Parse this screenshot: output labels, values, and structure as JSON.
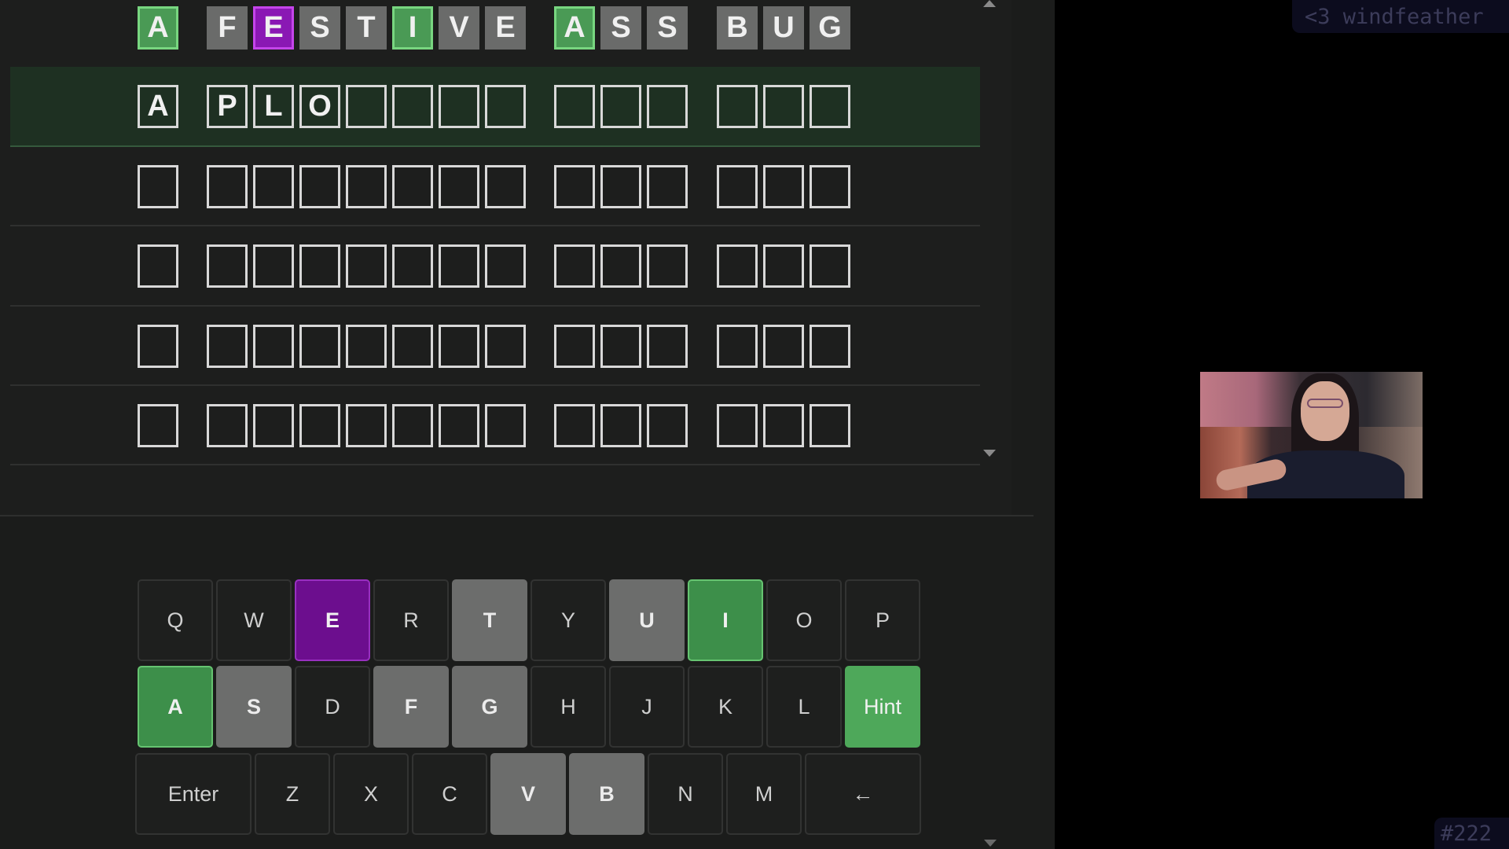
{
  "board": {
    "rows": [
      {
        "state": "revealed",
        "words": [
          [
            {
              "l": "A",
              "s": "green"
            }
          ],
          [
            {
              "l": "F",
              "s": "gray"
            },
            {
              "l": "E",
              "s": "purple"
            },
            {
              "l": "S",
              "s": "gray"
            },
            {
              "l": "T",
              "s": "gray"
            },
            {
              "l": "I",
              "s": "green"
            },
            {
              "l": "V",
              "s": "gray"
            },
            {
              "l": "E",
              "s": "gray"
            }
          ],
          [
            {
              "l": "A",
              "s": "green"
            },
            {
              "l": "S",
              "s": "gray"
            },
            {
              "l": "S",
              "s": "gray"
            }
          ],
          [
            {
              "l": "B",
              "s": "gray"
            },
            {
              "l": "U",
              "s": "gray"
            },
            {
              "l": "G",
              "s": "gray"
            }
          ]
        ]
      },
      {
        "state": "active",
        "words": [
          [
            {
              "l": "A",
              "s": "empty"
            }
          ],
          [
            {
              "l": "P",
              "s": "empty"
            },
            {
              "l": "L",
              "s": "empty"
            },
            {
              "l": "O",
              "s": "empty"
            },
            {
              "l": "",
              "s": "empty"
            },
            {
              "l": "",
              "s": "empty"
            },
            {
              "l": "",
              "s": "empty"
            },
            {
              "l": "",
              "s": "empty"
            }
          ],
          [
            {
              "l": "",
              "s": "empty"
            },
            {
              "l": "",
              "s": "empty"
            },
            {
              "l": "",
              "s": "empty"
            }
          ],
          [
            {
              "l": "",
              "s": "empty"
            },
            {
              "l": "",
              "s": "empty"
            },
            {
              "l": "",
              "s": "empty"
            }
          ]
        ]
      },
      {
        "state": "empty",
        "words": [
          [
            {
              "l": "",
              "s": "empty"
            }
          ],
          [
            {
              "l": "",
              "s": "empty"
            },
            {
              "l": "",
              "s": "empty"
            },
            {
              "l": "",
              "s": "empty"
            },
            {
              "l": "",
              "s": "empty"
            },
            {
              "l": "",
              "s": "empty"
            },
            {
              "l": "",
              "s": "empty"
            },
            {
              "l": "",
              "s": "empty"
            }
          ],
          [
            {
              "l": "",
              "s": "empty"
            },
            {
              "l": "",
              "s": "empty"
            },
            {
              "l": "",
              "s": "empty"
            }
          ],
          [
            {
              "l": "",
              "s": "empty"
            },
            {
              "l": "",
              "s": "empty"
            },
            {
              "l": "",
              "s": "empty"
            }
          ]
        ]
      },
      {
        "state": "empty",
        "words": [
          [
            {
              "l": "",
              "s": "empty"
            }
          ],
          [
            {
              "l": "",
              "s": "empty"
            },
            {
              "l": "",
              "s": "empty"
            },
            {
              "l": "",
              "s": "empty"
            },
            {
              "l": "",
              "s": "empty"
            },
            {
              "l": "",
              "s": "empty"
            },
            {
              "l": "",
              "s": "empty"
            },
            {
              "l": "",
              "s": "empty"
            }
          ],
          [
            {
              "l": "",
              "s": "empty"
            },
            {
              "l": "",
              "s": "empty"
            },
            {
              "l": "",
              "s": "empty"
            }
          ],
          [
            {
              "l": "",
              "s": "empty"
            },
            {
              "l": "",
              "s": "empty"
            },
            {
              "l": "",
              "s": "empty"
            }
          ]
        ]
      },
      {
        "state": "empty",
        "words": [
          [
            {
              "l": "",
              "s": "empty"
            }
          ],
          [
            {
              "l": "",
              "s": "empty"
            },
            {
              "l": "",
              "s": "empty"
            },
            {
              "l": "",
              "s": "empty"
            },
            {
              "l": "",
              "s": "empty"
            },
            {
              "l": "",
              "s": "empty"
            },
            {
              "l": "",
              "s": "empty"
            },
            {
              "l": "",
              "s": "empty"
            }
          ],
          [
            {
              "l": "",
              "s": "empty"
            },
            {
              "l": "",
              "s": "empty"
            },
            {
              "l": "",
              "s": "empty"
            }
          ],
          [
            {
              "l": "",
              "s": "empty"
            },
            {
              "l": "",
              "s": "empty"
            },
            {
              "l": "",
              "s": "empty"
            }
          ]
        ]
      },
      {
        "state": "empty",
        "words": [
          [
            {
              "l": "",
              "s": "empty"
            }
          ],
          [
            {
              "l": "",
              "s": "empty"
            },
            {
              "l": "",
              "s": "empty"
            },
            {
              "l": "",
              "s": "empty"
            },
            {
              "l": "",
              "s": "empty"
            },
            {
              "l": "",
              "s": "empty"
            },
            {
              "l": "",
              "s": "empty"
            },
            {
              "l": "",
              "s": "empty"
            }
          ],
          [
            {
              "l": "",
              "s": "empty"
            },
            {
              "l": "",
              "s": "empty"
            },
            {
              "l": "",
              "s": "empty"
            }
          ],
          [
            {
              "l": "",
              "s": "empty"
            },
            {
              "l": "",
              "s": "empty"
            },
            {
              "l": "",
              "s": "empty"
            }
          ]
        ]
      }
    ]
  },
  "keyboard": {
    "rows": [
      [
        {
          "k": "Q",
          "s": "unused"
        },
        {
          "k": "W",
          "s": "unused"
        },
        {
          "k": "E",
          "s": "purple"
        },
        {
          "k": "R",
          "s": "unused"
        },
        {
          "k": "T",
          "s": "gray"
        },
        {
          "k": "Y",
          "s": "unused"
        },
        {
          "k": "U",
          "s": "gray"
        },
        {
          "k": "I",
          "s": "green"
        },
        {
          "k": "O",
          "s": "unused"
        },
        {
          "k": "P",
          "s": "unused"
        }
      ],
      [
        {
          "k": "A",
          "s": "green"
        },
        {
          "k": "S",
          "s": "gray"
        },
        {
          "k": "D",
          "s": "unused"
        },
        {
          "k": "F",
          "s": "gray"
        },
        {
          "k": "G",
          "s": "gray"
        },
        {
          "k": "H",
          "s": "unused"
        },
        {
          "k": "J",
          "s": "unused"
        },
        {
          "k": "K",
          "s": "unused"
        },
        {
          "k": "L",
          "s": "unused"
        },
        {
          "k": "Hint",
          "s": "hint"
        }
      ],
      [
        {
          "k": "Enter",
          "s": "unused",
          "wide": true
        },
        {
          "k": "Z",
          "s": "unused"
        },
        {
          "k": "X",
          "s": "unused"
        },
        {
          "k": "C",
          "s": "unused"
        },
        {
          "k": "V",
          "s": "gray"
        },
        {
          "k": "B",
          "s": "gray"
        },
        {
          "k": "N",
          "s": "unused"
        },
        {
          "k": "M",
          "s": "unused"
        },
        {
          "k": "←",
          "s": "unused",
          "wide": true
        }
      ]
    ]
  },
  "overlay": {
    "credit": "<3 windfeather",
    "tag": "#222"
  },
  "colors": {
    "green": "#4a9a55",
    "purple": "#8a18b4",
    "gray": "#6a6b6a",
    "background": "#1b1c1b"
  }
}
